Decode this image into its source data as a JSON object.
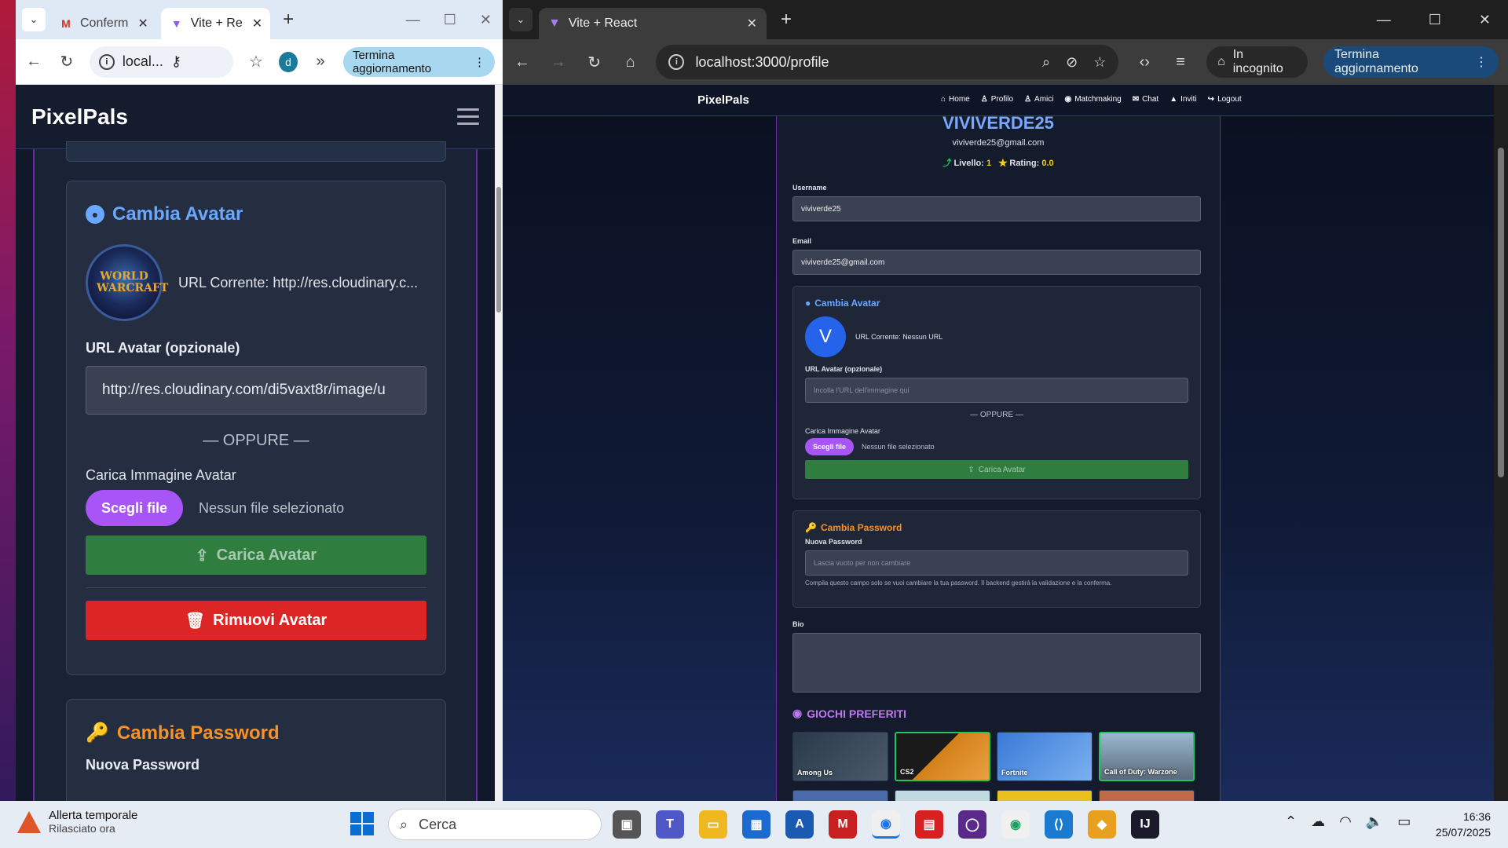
{
  "left_browser": {
    "tabs": [
      {
        "label": "Conferm",
        "favicon": "gmail-icon"
      },
      {
        "label": "Vite + Re",
        "favicon": "vite-icon"
      }
    ],
    "address": "local...",
    "profile_initial": "d",
    "update_button": "Termina aggiornamento",
    "page": {
      "brand": "PixelPals",
      "avatar_section": {
        "title": "Cambia Avatar",
        "avatar_text": "WORLD WARCRAFT",
        "current_url": "URL Corrente: http://res.cloudinary.c...",
        "url_label": "URL Avatar (opzionale)",
        "url_value": "http://res.cloudinary.com/di5vaxt8r/image/u",
        "or": "— OPPURE —",
        "upload_label": "Carica Immagine Avatar",
        "choose_file": "Scegli file",
        "no_file": "Nessun file selezionato",
        "upload_button": "Carica Avatar",
        "remove_button": "Rimuovi Avatar"
      },
      "password_section": {
        "title": "Cambia Password",
        "new_password_label": "Nuova Password"
      }
    }
  },
  "right_browser": {
    "tab_title": "Vite + React",
    "address": "localhost:3000/profile",
    "incognito_label": "In incognito",
    "update_button": "Termina aggiornamento",
    "page": {
      "brand": "PixelPals",
      "nav_links": [
        {
          "icon": "home-icon",
          "label": "Home"
        },
        {
          "icon": "user-icon",
          "label": "Profilo"
        },
        {
          "icon": "users-icon",
          "label": "Amici"
        },
        {
          "icon": "gamepad-icon",
          "label": "Matchmaking"
        },
        {
          "icon": "envelope-icon",
          "label": "Chat"
        },
        {
          "icon": "send-icon",
          "label": "Inviti"
        },
        {
          "icon": "logout-icon",
          "label": "Logout"
        }
      ],
      "username_title": "VIVIVERDE25",
      "email": "viviverde25@gmail.com",
      "level_label": "Livello:",
      "level_value": "1",
      "rating_label": "Rating:",
      "rating_value": "0.0",
      "form": {
        "username_label": "Username",
        "username_value": "viviverde25",
        "email_label": "Email",
        "email_value": "viviverde25@gmail.com",
        "bio_label": "Bio"
      },
      "avatar_section": {
        "title": "Cambia Avatar",
        "avatar_initial": "V",
        "current_url": "URL Corrente: Nessun URL",
        "url_label": "URL Avatar (opzionale)",
        "url_placeholder": "Incolla l'URL dell'immagine qui",
        "or": "— OPPURE —",
        "upload_label": "Carica Immagine Avatar",
        "choose_file": "Scegli file",
        "no_file": "Nessun file selezionato",
        "upload_button": "Carica Avatar"
      },
      "password_section": {
        "title": "Cambia Password",
        "new_password_label": "Nuova Password",
        "placeholder": "Lascia vuoto per non cambiare",
        "hint": "Compila questo campo solo se vuoi cambiare la tua password. Il backend gestirà la validazione e la conferma."
      },
      "games_section": {
        "title": "GIOCHI PREFERITI",
        "games": [
          {
            "name": "Among Us",
            "selected": false,
            "color": "#3a4a5a"
          },
          {
            "name": "CS2",
            "selected": true,
            "color": "#d4801a"
          },
          {
            "name": "Fortnite",
            "selected": false,
            "color": "#3a7ad8"
          },
          {
            "name": "Call of Duty: Warzone",
            "selected": true,
            "color": "#7a9ab8"
          }
        ]
      }
    }
  },
  "taskbar": {
    "weather_title": "Allerta temporale",
    "weather_sub": "Rilasciato ora",
    "search_placeholder": "Cerca",
    "time": "16:36",
    "date": "25/07/2025"
  },
  "colors": {
    "avatar_title": "#6aa8ff",
    "password_title": "#f5922a",
    "games_title": "#c07af0",
    "green_button": "#2f7d3f",
    "red_button": "#dc2626",
    "choose_file": "#a855f7"
  }
}
